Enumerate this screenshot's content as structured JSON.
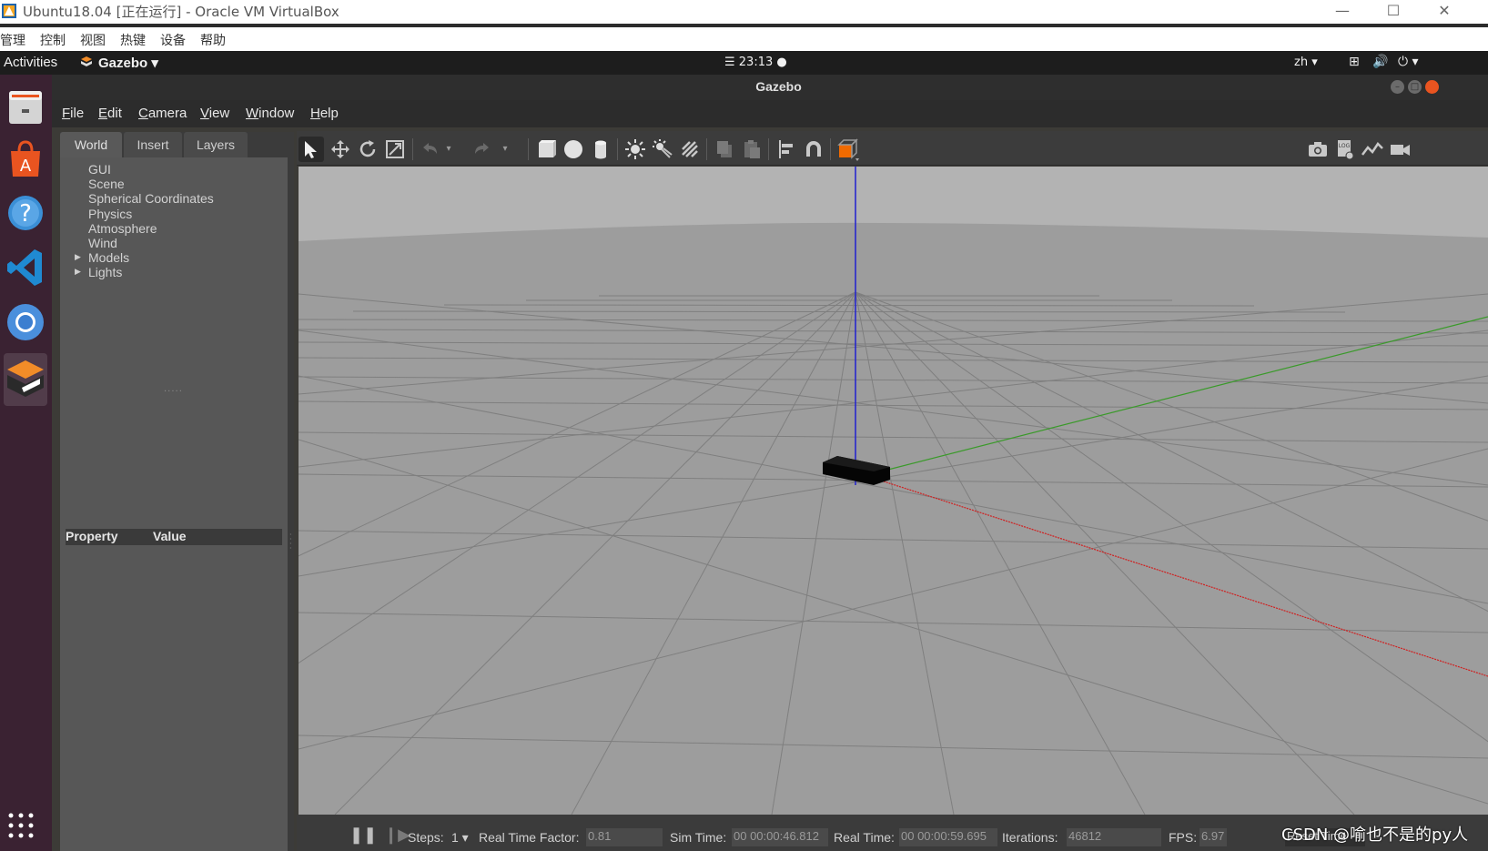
{
  "host_window": {
    "title": "Ubuntu18.04 [正在运行] - Oracle VM VirtualBox",
    "minimize": "—",
    "maximize": "☐",
    "close": "✕",
    "menu": [
      "管理",
      "控制",
      "视图",
      "热键",
      "设备",
      "帮助"
    ]
  },
  "topbar": {
    "activities": "Activities",
    "app_name": "Gazebo ▾",
    "clock": "☰ 23:13 ●",
    "language": "zh ▾",
    "network_icon": "⊞",
    "volume_icon": "🔊",
    "power_icon": "⏻ ▾"
  },
  "dock": {
    "launchers": [
      "files",
      "software-center",
      "help",
      "vscode",
      "chromium",
      "gazebo"
    ],
    "app_grid": "⋮⋮⋮"
  },
  "gazebo": {
    "window_title": "Gazebo",
    "menu": [
      "File",
      "Edit",
      "Camera",
      "View",
      "Window",
      "Help"
    ],
    "tabs": [
      "World",
      "Insert",
      "Layers"
    ],
    "world_tree": [
      "GUI",
      "Scene",
      "Spherical Coordinates",
      "Physics",
      "Atmosphere",
      "Wind",
      "Models",
      "Lights"
    ],
    "property_header": {
      "property": "Property",
      "value": "Value"
    },
    "toolbar": {
      "left_tools": [
        "select-icon",
        "translate-icon",
        "rotate-icon",
        "scale-icon",
        "undo-icon",
        "redo-icon",
        "box-icon",
        "sphere-icon",
        "cylinder-icon",
        "point-light-icon",
        "spot-light-icon",
        "directional-light-icon",
        "copy-icon",
        "paste-icon",
        "align-icon",
        "snap-icon",
        "view-angle-icon"
      ],
      "right_tools": [
        "screenshot-icon",
        "log-icon",
        "plot-icon",
        "record-video-icon"
      ]
    },
    "status": {
      "pause": "❚❚",
      "step": "❙▶",
      "steps_label": "Steps:",
      "steps_value": "1 ▾",
      "rtf_label": "Real Time Factor:",
      "rtf_value": "0.81",
      "sim_time_label": "Sim Time:",
      "sim_time_value": "00 00:00:46.812",
      "real_time_label": "Real Time:",
      "real_time_value": "00 00:00:59.695",
      "iterations_label": "Iterations:",
      "iterations_value": "46812",
      "fps_label": "FPS:",
      "fps_value": "6.97",
      "reset_time": "Reset Time"
    }
  },
  "watermark": "CSDN @喻也不是的py人",
  "colors": {
    "sky": "#b3b3b3",
    "ground": "#9d9d9d",
    "grid": "#7a7a7a",
    "axis_x": "#d02020",
    "axis_y": "#3a9a2a",
    "axis_z": "#2020d0",
    "dock_bg": "#3a2232",
    "accent_orange": "#e95420"
  }
}
